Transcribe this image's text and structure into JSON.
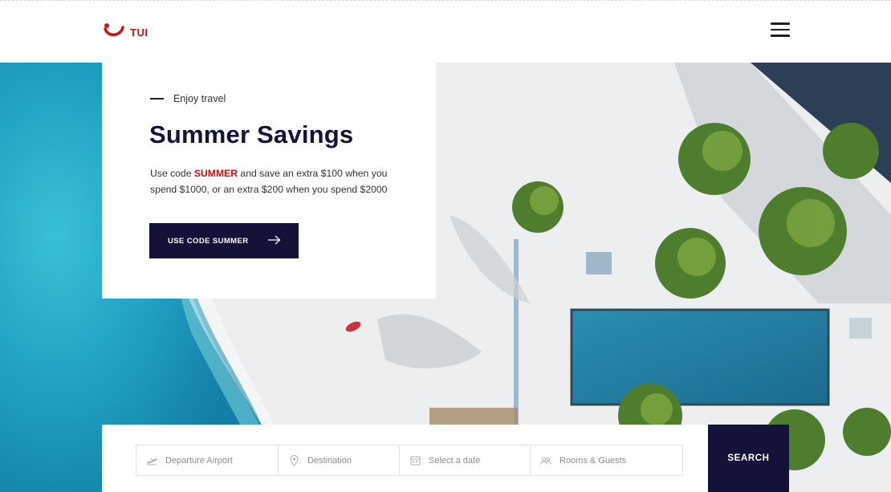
{
  "header": {
    "logo_text": "TUI",
    "menu_icon": "hamburger-menu-icon"
  },
  "promo": {
    "eyebrow": "Enjoy travel",
    "title": "Summer Savings",
    "desc_before": "Use code ",
    "code": "SUMMER",
    "desc_after": " and save an extra $100 when you spend $1000, or an extra $200 when you spend $2000",
    "cta_label": "USE CODE SUMMER",
    "cta_icon": "arrow-right-icon"
  },
  "search": {
    "fields": [
      {
        "label": "Departure Airport",
        "icon": "plane-takeoff-icon"
      },
      {
        "label": "Destination",
        "icon": "location-pin-icon"
      },
      {
        "label": "Select a date",
        "icon": "calendar-icon"
      },
      {
        "label": "Rooms & Guests",
        "icon": "guests-icon"
      }
    ],
    "button_label": "SEARCH"
  },
  "colors": {
    "brand_red": "#d40e14",
    "navy": "#15123a",
    "ocean": "#2aa8c4"
  }
}
